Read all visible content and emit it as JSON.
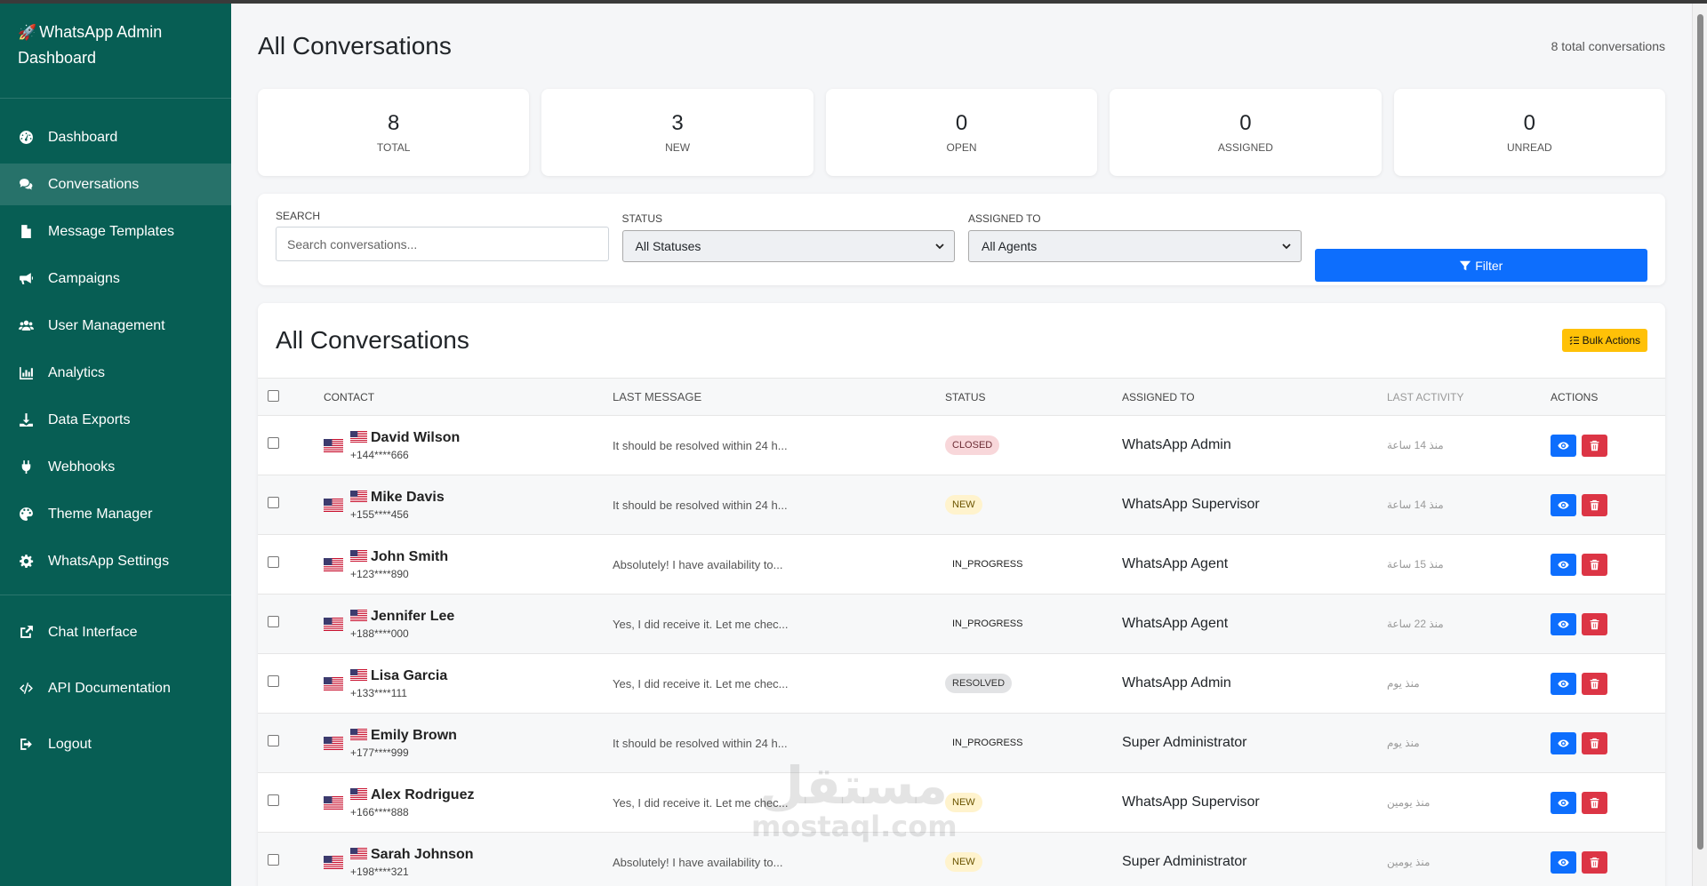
{
  "sidebar": {
    "brand_title": "WhatsApp Admin Dashboard",
    "items": [
      {
        "label": "Dashboard",
        "icon": "dashboard-icon"
      },
      {
        "label": "Conversations",
        "icon": "comments-icon"
      },
      {
        "label": "Message Templates",
        "icon": "file-icon"
      },
      {
        "label": "Campaigns",
        "icon": "bullhorn-icon"
      },
      {
        "label": "User Management",
        "icon": "users-icon"
      },
      {
        "label": "Analytics",
        "icon": "chart-icon"
      },
      {
        "label": "Data Exports",
        "icon": "download-icon"
      },
      {
        "label": "Webhooks",
        "icon": "plug-icon"
      },
      {
        "label": "Theme Manager",
        "icon": "palette-icon"
      },
      {
        "label": "WhatsApp Settings",
        "icon": "gear-icon"
      }
    ],
    "bottom_items": [
      {
        "label": "Chat Interface",
        "icon": "external-link-icon"
      },
      {
        "label": "API Documentation",
        "icon": "code-icon"
      },
      {
        "label": "Logout",
        "icon": "logout-icon"
      }
    ]
  },
  "header": {
    "title": "All Conversations",
    "total_text": "8 total conversations"
  },
  "stats": [
    {
      "value": "8",
      "label": "Total"
    },
    {
      "value": "3",
      "label": "New"
    },
    {
      "value": "0",
      "label": "Open"
    },
    {
      "value": "0",
      "label": "Assigned"
    },
    {
      "value": "0",
      "label": "Unread"
    }
  ],
  "filters": {
    "search_label": "Search",
    "search_placeholder": "Search conversations...",
    "status_label": "Status",
    "status_value": "All Statuses",
    "assigned_label": "Assigned To",
    "assigned_value": "All Agents",
    "filter_button": "Filter"
  },
  "table": {
    "title": "All Conversations",
    "bulk_actions": "Bulk Actions",
    "columns": [
      "Contact",
      "Last Message",
      "Status",
      "Assigned To",
      "Last Activity",
      "Actions"
    ],
    "rows": [
      {
        "name": "David Wilson",
        "phone": "+144****666",
        "message": "It should be resolved within 24 h...",
        "status": "CLOSED",
        "status_class": "closed",
        "assigned": "WhatsApp Admin",
        "activity": "منذ 14 ساعة"
      },
      {
        "name": "Mike Davis",
        "phone": "+155****456",
        "message": "It should be resolved within 24 h...",
        "status": "NEW",
        "status_class": "new",
        "assigned": "WhatsApp Supervisor",
        "activity": "منذ 14 ساعة"
      },
      {
        "name": "John Smith",
        "phone": "+123****890",
        "message": "Absolutely! I have availability to...",
        "status": "IN_PROGRESS",
        "status_class": "in_progress",
        "assigned": "WhatsApp Agent",
        "activity": "منذ 15 ساعة"
      },
      {
        "name": "Jennifer Lee",
        "phone": "+188****000",
        "message": "Yes, I did receive it. Let me chec...",
        "status": "IN_PROGRESS",
        "status_class": "in_progress",
        "assigned": "WhatsApp Agent",
        "activity": "منذ 22 ساعة"
      },
      {
        "name": "Lisa Garcia",
        "phone": "+133****111",
        "message": "Yes, I did receive it. Let me chec...",
        "status": "RESOLVED",
        "status_class": "resolved",
        "assigned": "WhatsApp Admin",
        "activity": "منذ يوم"
      },
      {
        "name": "Emily Brown",
        "phone": "+177****999",
        "message": "It should be resolved within 24 h...",
        "status": "IN_PROGRESS",
        "status_class": "in_progress",
        "assigned": "Super Administrator",
        "activity": "منذ يوم"
      },
      {
        "name": "Alex Rodriguez",
        "phone": "+166****888",
        "message": "Yes, I did receive it. Let me chec...",
        "status": "NEW",
        "status_class": "new",
        "assigned": "WhatsApp Supervisor",
        "activity": "منذ يومين"
      },
      {
        "name": "Sarah Johnson",
        "phone": "+198****321",
        "message": "Absolutely! I have availability to...",
        "status": "NEW",
        "status_class": "new",
        "assigned": "Super Administrator",
        "activity": "منذ يومين"
      }
    ]
  },
  "watermark": {
    "arabic": "مستقل",
    "latin": "mostaql.com"
  },
  "colors": {
    "sidebar": "#075e54",
    "primary": "#0d6efd",
    "danger": "#dc3545",
    "warning": "#ffc107"
  }
}
